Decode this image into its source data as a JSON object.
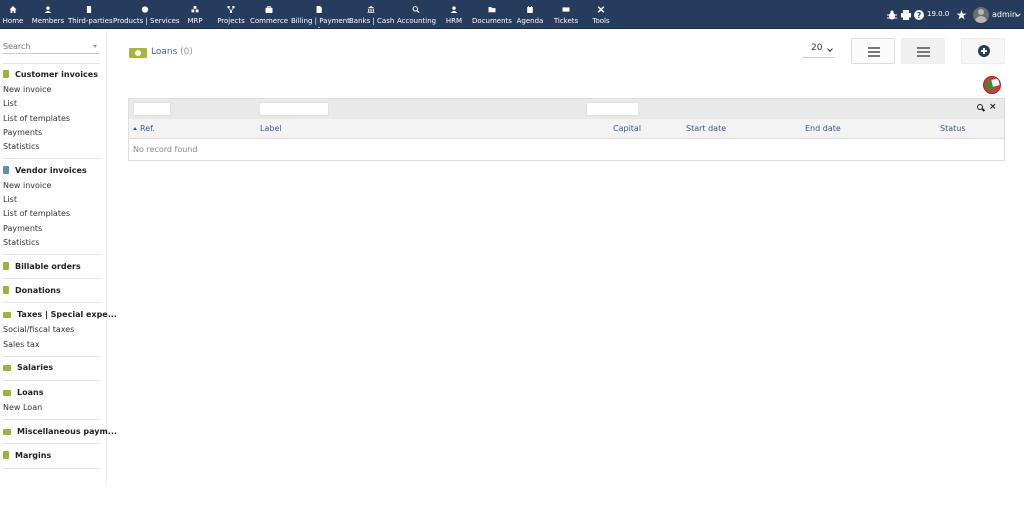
{
  "topbar": {
    "menu": [
      {
        "label": "Home",
        "icon": "home-icon"
      },
      {
        "label": "Members",
        "icon": "user-icon"
      },
      {
        "label": "Third-parties",
        "icon": "building-icon"
      },
      {
        "label": "Products | Services",
        "icon": "cube-icon"
      },
      {
        "label": "MRP",
        "icon": "cubes-icon"
      },
      {
        "label": "Projects",
        "icon": "sitemap-icon"
      },
      {
        "label": "Commerce",
        "icon": "suitcase-icon"
      },
      {
        "label": "Billing | Payment",
        "icon": "file-invoice-icon"
      },
      {
        "label": "Banks | Cash",
        "icon": "bank-icon"
      },
      {
        "label": "Accounting",
        "icon": "search-dollar-icon"
      },
      {
        "label": "HRM",
        "icon": "user-tie-icon"
      },
      {
        "label": "Documents",
        "icon": "folder-icon"
      },
      {
        "label": "Agenda",
        "icon": "calendar-icon"
      },
      {
        "label": "Tickets",
        "icon": "ticket-icon"
      },
      {
        "label": "Tools",
        "icon": "tools-icon"
      }
    ],
    "active_menu": "Billing | Payment",
    "version": "19.0.0",
    "username": "admin"
  },
  "sidebar": {
    "search_placeholder": "Search",
    "sections": [
      {
        "title": "Customer invoices",
        "items": [
          "New invoice",
          "List",
          "List of templates",
          "Payments",
          "Statistics"
        ]
      },
      {
        "title": "Vendor invoices",
        "items": [
          "New invoice",
          "List",
          "List of templates",
          "Payments",
          "Statistics"
        ]
      },
      {
        "title": "Billable orders",
        "items": []
      },
      {
        "title": "Donations",
        "items": []
      },
      {
        "title": "Taxes | Special expe...",
        "items": [
          "Social/fiscal taxes",
          "Sales tax"
        ]
      },
      {
        "title": "Salaries",
        "items": []
      },
      {
        "title": "Loans",
        "items": [
          "New Loan"
        ]
      },
      {
        "title": "Miscellaneous paym...",
        "items": []
      },
      {
        "title": "Margins",
        "items": []
      }
    ]
  },
  "main": {
    "title": "Loans",
    "count": "(0)",
    "limit": "20",
    "columns": [
      "Ref.",
      "Label",
      "Capital",
      "Start date",
      "End date",
      "Status"
    ],
    "empty_message": "No record found",
    "clear_glyph": "×"
  },
  "colors": {
    "topbar": "#263c5c",
    "link": "#3a6ea5",
    "badge": "#a9b43a"
  }
}
